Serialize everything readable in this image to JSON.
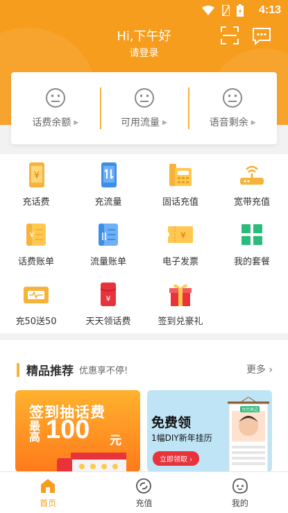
{
  "status_bar": {
    "time": "4:13"
  },
  "header": {
    "greeting": "Hi,下午好",
    "login_label": "请登录"
  },
  "balances": [
    {
      "label": "话费余额",
      "icon": "neutral-face-icon"
    },
    {
      "label": "可用流量",
      "icon": "neutral-face-icon"
    },
    {
      "label": "语音剩余",
      "icon": "neutral-face-icon"
    }
  ],
  "services": [
    {
      "label": "充话费",
      "icon": "phone-recharge-icon"
    },
    {
      "label": "充流量",
      "icon": "data-recharge-icon"
    },
    {
      "label": "固话充值",
      "icon": "landline-icon"
    },
    {
      "label": "宽带充值",
      "icon": "router-icon"
    },
    {
      "label": "话费账单",
      "icon": "phone-bill-icon"
    },
    {
      "label": "流量账单",
      "icon": "data-bill-icon"
    },
    {
      "label": "电子发票",
      "icon": "invoice-icon"
    },
    {
      "label": "我的套餐",
      "icon": "plan-grid-icon"
    },
    {
      "label": "充50送50",
      "icon": "promo-card-icon"
    },
    {
      "label": "天天领话费",
      "icon": "red-envelope-icon"
    },
    {
      "label": "签到兑豪礼",
      "icon": "gift-icon"
    }
  ],
  "recommend": {
    "title": "精品推荐",
    "subtitle": "优惠享不停!",
    "more": "更多",
    "banner1": {
      "line1": "签到抽话费",
      "line2a": "最",
      "line2b": "高",
      "amount": "100",
      "unit": "元"
    },
    "banner2": {
      "title": "免费领",
      "subtitle": "1幅DIY新年挂历",
      "cta": "立即领取 ›",
      "poster_tag": "台历周边"
    }
  },
  "tabs": [
    {
      "label": "首页",
      "icon": "home-icon",
      "active": true
    },
    {
      "label": "充值",
      "icon": "recharge-icon",
      "active": false
    },
    {
      "label": "我的",
      "icon": "profile-icon",
      "active": false
    }
  ],
  "colors": {
    "brand": "#f79d1e",
    "accent_blue": "#3d8ee6",
    "accent_green": "#2dbb7c",
    "accent_red": "#e8333a"
  }
}
